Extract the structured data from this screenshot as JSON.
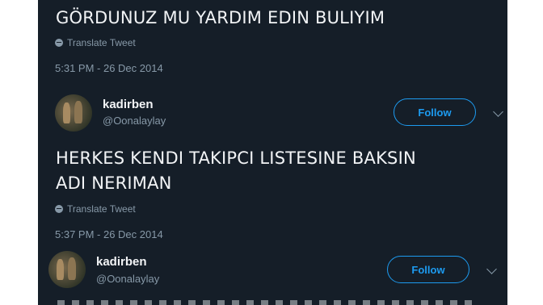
{
  "tweet_top": {
    "text": "GÖRDUNUZ MU YARDIM EDIN BULIYIM",
    "translate_label": "Translate Tweet",
    "timestamp": "5:31 PM - 26 Dec 2014"
  },
  "reply_1": {
    "username": "kadirben",
    "handle": "@Oonalaylay",
    "follow_label": "Follow",
    "text_line1": "HERKES KENDI TAKIPCI LISTESINE BAKSIN",
    "text_line2": "ADI NERIMAN",
    "translate_label": "Translate Tweet",
    "timestamp": "5:37 PM - 26 Dec 2014"
  },
  "reply_2": {
    "username": "kadirben",
    "handle": "@Oonalaylay",
    "follow_label": "Follow"
  },
  "colors": {
    "background": "#151e28",
    "text": "#f2f4f6",
    "muted": "#8799a8",
    "accent": "#1d9bf0"
  }
}
